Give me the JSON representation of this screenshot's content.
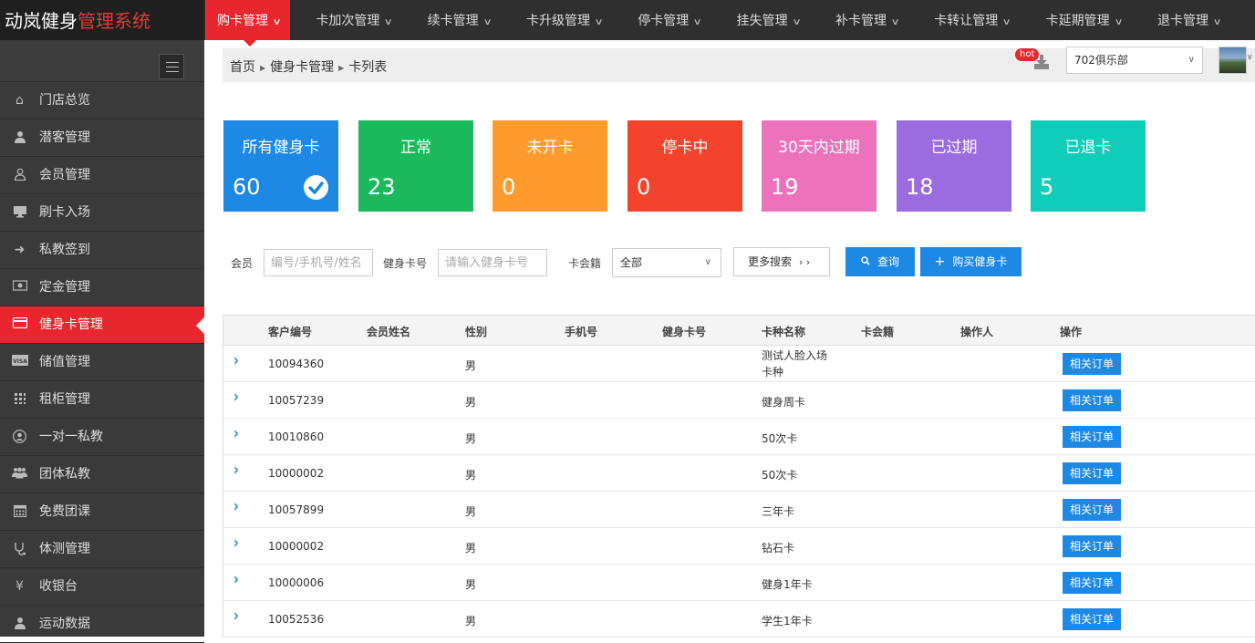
{
  "brand": {
    "part1": "动岚健身",
    "part2": "管理系统"
  },
  "topnav": [
    {
      "label": "购卡管理",
      "active": true
    },
    {
      "label": "卡加次管理"
    },
    {
      "label": "续卡管理"
    },
    {
      "label": "卡升级管理"
    },
    {
      "label": "停卡管理"
    },
    {
      "label": "挂失管理"
    },
    {
      "label": "补卡管理"
    },
    {
      "label": "卡转让管理"
    },
    {
      "label": "卡延期管理"
    },
    {
      "label": "退卡管理"
    }
  ],
  "sidebar": {
    "items": [
      {
        "label": "门店总览",
        "icon": "home-icon"
      },
      {
        "label": "潜客管理",
        "icon": "user-icon"
      },
      {
        "label": "会员管理",
        "icon": "user-outline-icon"
      },
      {
        "label": "刷卡入场",
        "icon": "desktop-icon"
      },
      {
        "label": "私教签到",
        "icon": "sign-in-icon"
      },
      {
        "label": "定金管理",
        "icon": "money-icon"
      },
      {
        "label": "健身卡管理",
        "icon": "credit-card-icon",
        "active": true
      },
      {
        "label": "储值管理",
        "icon": "visa-icon"
      },
      {
        "label": "租柜管理",
        "icon": "grid-icon"
      },
      {
        "label": "一对一私教",
        "icon": "user-circle-icon"
      },
      {
        "label": "团体私教",
        "icon": "users-icon"
      },
      {
        "label": "免费团课",
        "icon": "calendar-icon"
      },
      {
        "label": "体测管理",
        "icon": "stethoscope-icon"
      },
      {
        "label": "收银台",
        "icon": "yen-icon"
      },
      {
        "label": "运动数据",
        "icon": "user-data-icon"
      }
    ]
  },
  "breadcrumb": [
    "首页",
    "健身卡管理",
    "卡列表"
  ],
  "header": {
    "hot_badge": "hot",
    "club": "702俱乐部"
  },
  "stats": [
    {
      "title": "所有健身卡",
      "value": "60",
      "color": "#1e88e5"
    },
    {
      "title": "正常",
      "value": "23",
      "color": "#1cb85c"
    },
    {
      "title": "未开卡",
      "value": "0",
      "color": "#ff9a2f"
    },
    {
      "title": "停卡中",
      "value": "0",
      "color": "#f4432d"
    },
    {
      "title": "30天内过期",
      "value": "19",
      "color": "#ec72bb"
    },
    {
      "title": "已过期",
      "value": "18",
      "color": "#9b6be0"
    },
    {
      "title": "已退卡",
      "value": "5",
      "color": "#10cdb9"
    }
  ],
  "filters": {
    "member_label": "会员",
    "member_placeholder": "编号/手机号/姓名",
    "card_no_label": "健身卡号",
    "card_no_placeholder": "请输入健身卡号",
    "club_label": "卡会籍",
    "club_value": "全部",
    "more_search": "更多搜索",
    "search_btn": "查询",
    "buy_btn": "购买健身卡"
  },
  "table": {
    "columns": [
      "客户编号",
      "会员姓名",
      "性别",
      "手机号",
      "健身卡号",
      "卡种名称",
      "卡会籍",
      "操作人",
      "操作"
    ],
    "action_label": "相关订单",
    "rows": [
      {
        "id": "10094360",
        "gender": "男",
        "card_name_line1": "测试人脸入场",
        "card_name_line2": "卡种"
      },
      {
        "id": "10057239",
        "gender": "男",
        "card_name": "健身周卡"
      },
      {
        "id": "10010860",
        "gender": "男",
        "card_name": "50次卡"
      },
      {
        "id": "10000002",
        "gender": "男",
        "card_name": "50次卡"
      },
      {
        "id": "10057899",
        "gender": "男",
        "card_name": "三年卡"
      },
      {
        "id": "10000002",
        "gender": "男",
        "card_name": "钻石卡"
      },
      {
        "id": "10000006",
        "gender": "男",
        "card_name": "健身1年卡"
      },
      {
        "id": "10052536",
        "gender": "男",
        "card_name": "学生1年卡"
      }
    ]
  }
}
